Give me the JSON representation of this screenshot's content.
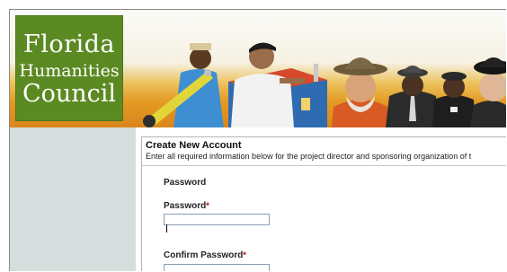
{
  "logo": {
    "line1": "Florida",
    "line2": "Humanities",
    "line3": "Council"
  },
  "colors": {
    "logo_green": "#5c8a22",
    "banner_orange": "#e49a24",
    "sidebar": "#d5dedd",
    "required_marker": "#b00000"
  },
  "form": {
    "title": "Create New Account",
    "subtitle": "Enter all required information below for the project director and sponsoring organization of t",
    "section_heading": "Password",
    "fields": [
      {
        "label": "Password",
        "required_marker": "*",
        "value": ""
      },
      {
        "label": "Confirm Password",
        "required_marker": "*",
        "value": ""
      }
    ]
  }
}
